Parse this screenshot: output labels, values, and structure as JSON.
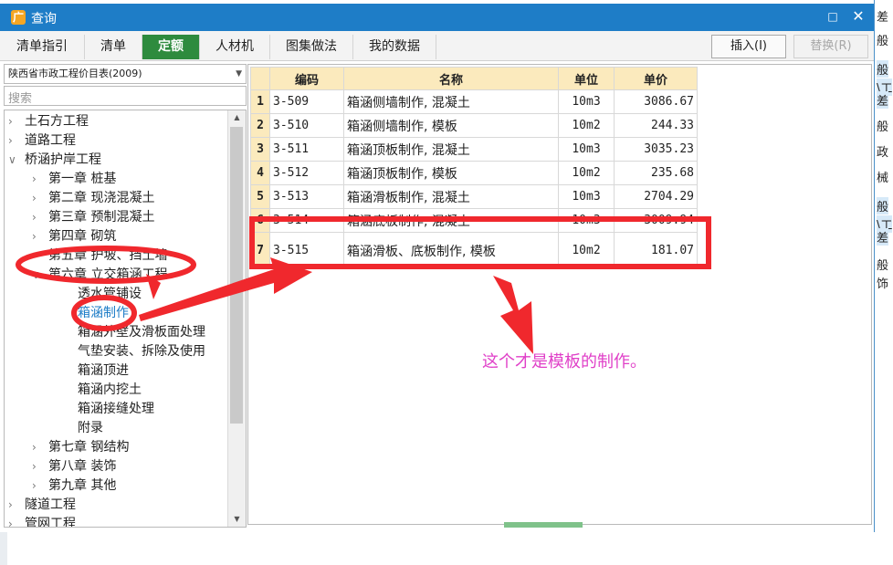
{
  "window": {
    "title": "查询",
    "logo": "广"
  },
  "background_right": [
    "差",
    "般",
    "般",
    "\\工",
    "差",
    "般",
    "政",
    "械",
    "般",
    "\\工",
    "差",
    "般",
    "饰"
  ],
  "tabs": [
    {
      "label": "清单指引",
      "active": false
    },
    {
      "label": "清单",
      "active": false
    },
    {
      "label": "定额",
      "active": true
    },
    {
      "label": "人材机",
      "active": false
    },
    {
      "label": "图集做法",
      "active": false
    },
    {
      "label": "我的数据",
      "active": false
    }
  ],
  "buttons": {
    "insert": "插入(I)",
    "replace": "替换(R)"
  },
  "left_panel": {
    "library": "陕西省市政工程价目表(2009)",
    "search_placeholder": "搜索",
    "tree": [
      {
        "label": "土石方工程",
        "level": 0,
        "expand": "collapsed"
      },
      {
        "label": "道路工程",
        "level": 0,
        "expand": "collapsed"
      },
      {
        "label": "桥涵护岸工程",
        "level": 0,
        "expand": "expanded"
      },
      {
        "label": "第一章  桩基",
        "level": 1,
        "expand": "collapsed"
      },
      {
        "label": "第二章  现浇混凝土",
        "level": 1,
        "expand": "collapsed"
      },
      {
        "label": "第三章  预制混凝土",
        "level": 1,
        "expand": "collapsed"
      },
      {
        "label": "第四章  砌筑",
        "level": 1,
        "expand": "collapsed"
      },
      {
        "label": "第五章  护坡、挡土墙",
        "level": 1,
        "expand": "collapsed"
      },
      {
        "label": "第六章  立交箱涵工程",
        "level": 1,
        "expand": "expanded"
      },
      {
        "label": "透水管铺设",
        "level": 2,
        "expand": "none"
      },
      {
        "label": "箱涵制作",
        "level": 2,
        "expand": "none",
        "selected": true
      },
      {
        "label": "箱涵外壁及滑板面处理",
        "level": 2,
        "expand": "none"
      },
      {
        "label": "气垫安装、拆除及使用",
        "level": 2,
        "expand": "none"
      },
      {
        "label": "箱涵顶进",
        "level": 2,
        "expand": "none"
      },
      {
        "label": "箱涵内挖土",
        "level": 2,
        "expand": "none"
      },
      {
        "label": "箱涵接缝处理",
        "level": 2,
        "expand": "none"
      },
      {
        "label": "附录",
        "level": 2,
        "expand": "none"
      },
      {
        "label": "第七章  钢结构",
        "level": 1,
        "expand": "collapsed"
      },
      {
        "label": "第八章  装饰",
        "level": 1,
        "expand": "collapsed"
      },
      {
        "label": "第九章  其他",
        "level": 1,
        "expand": "collapsed"
      },
      {
        "label": "隧道工程",
        "level": 0,
        "expand": "collapsed"
      },
      {
        "label": "管网工程",
        "level": 0,
        "expand": "collapsed"
      }
    ]
  },
  "table": {
    "columns": [
      "编码",
      "名称",
      "单位",
      "单价"
    ],
    "rows": [
      {
        "n": "1",
        "code": "3-509",
        "name": "箱涵侧墙制作, 混凝土",
        "unit": "10m3",
        "price": "3086.67"
      },
      {
        "n": "2",
        "code": "3-510",
        "name": "箱涵侧墙制作, 模板",
        "unit": "10m2",
        "price": "244.33"
      },
      {
        "n": "3",
        "code": "3-511",
        "name": "箱涵顶板制作, 混凝土",
        "unit": "10m3",
        "price": "3035.23"
      },
      {
        "n": "4",
        "code": "3-512",
        "name": "箱涵顶板制作, 模板",
        "unit": "10m2",
        "price": "235.68"
      },
      {
        "n": "5",
        "code": "3-513",
        "name": "箱涵滑板制作, 混凝土",
        "unit": "10m3",
        "price": "2704.29"
      },
      {
        "n": "6",
        "code": "3-514",
        "name": "箱涵底板制作, 混凝土",
        "unit": "10m3",
        "price": "3009.94"
      },
      {
        "n": "7",
        "code": "3-515",
        "name": "箱涵滑板、底板制作, 模板",
        "unit": "10m2",
        "price": "181.07"
      }
    ]
  },
  "annotation": {
    "text": "这个才是模板的制作。",
    "color": "#e040c8",
    "mark_color": "#f0282d"
  }
}
